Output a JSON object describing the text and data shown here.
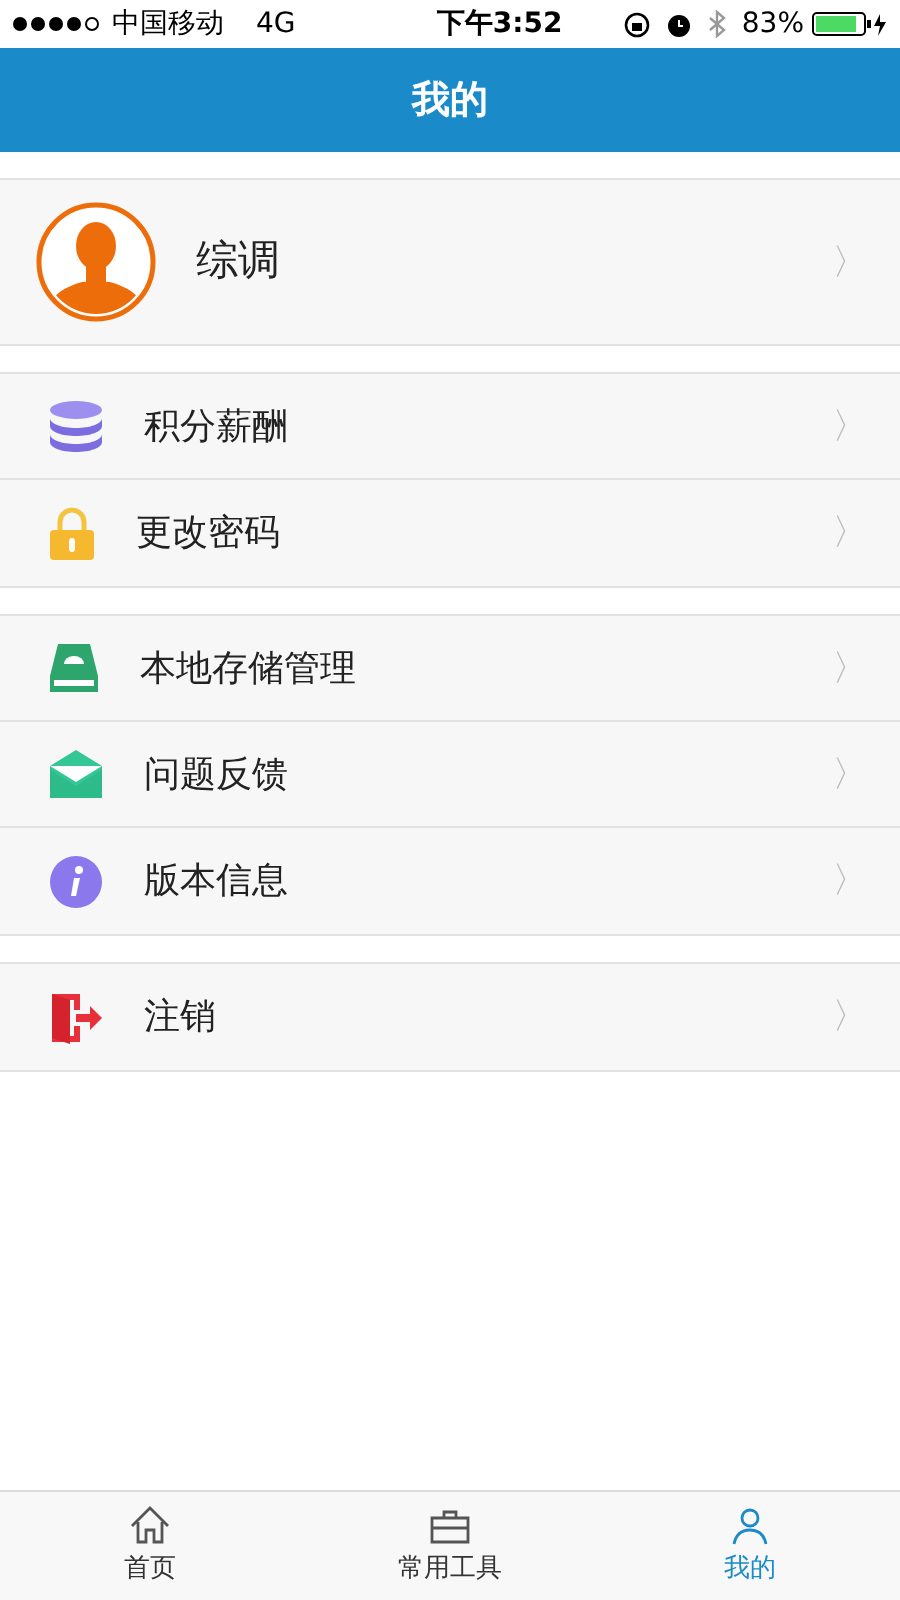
{
  "status_bar": {
    "carrier": "中国移动",
    "network": "4G",
    "time": "下午3:52",
    "battery": "83%"
  },
  "header": {
    "title": "我的"
  },
  "profile": {
    "name": "综调",
    "chevron": "〉"
  },
  "groups": [
    {
      "items": [
        {
          "label": "积分薪酬",
          "chevron": "〉"
        },
        {
          "label": "更改密码",
          "chevron": "〉"
        }
      ]
    },
    {
      "items": [
        {
          "label": "本地存储管理",
          "chevron": "〉"
        },
        {
          "label": "问题反馈",
          "chevron": "〉"
        },
        {
          "label": "版本信息",
          "chevron": "〉"
        }
      ]
    },
    {
      "items": [
        {
          "label": "注销",
          "chevron": "〉"
        }
      ]
    }
  ],
  "tab_bar": [
    {
      "label": "首页",
      "selected": false
    },
    {
      "label": "常用工具",
      "selected": false
    },
    {
      "label": "我的",
      "selected": true
    }
  ]
}
